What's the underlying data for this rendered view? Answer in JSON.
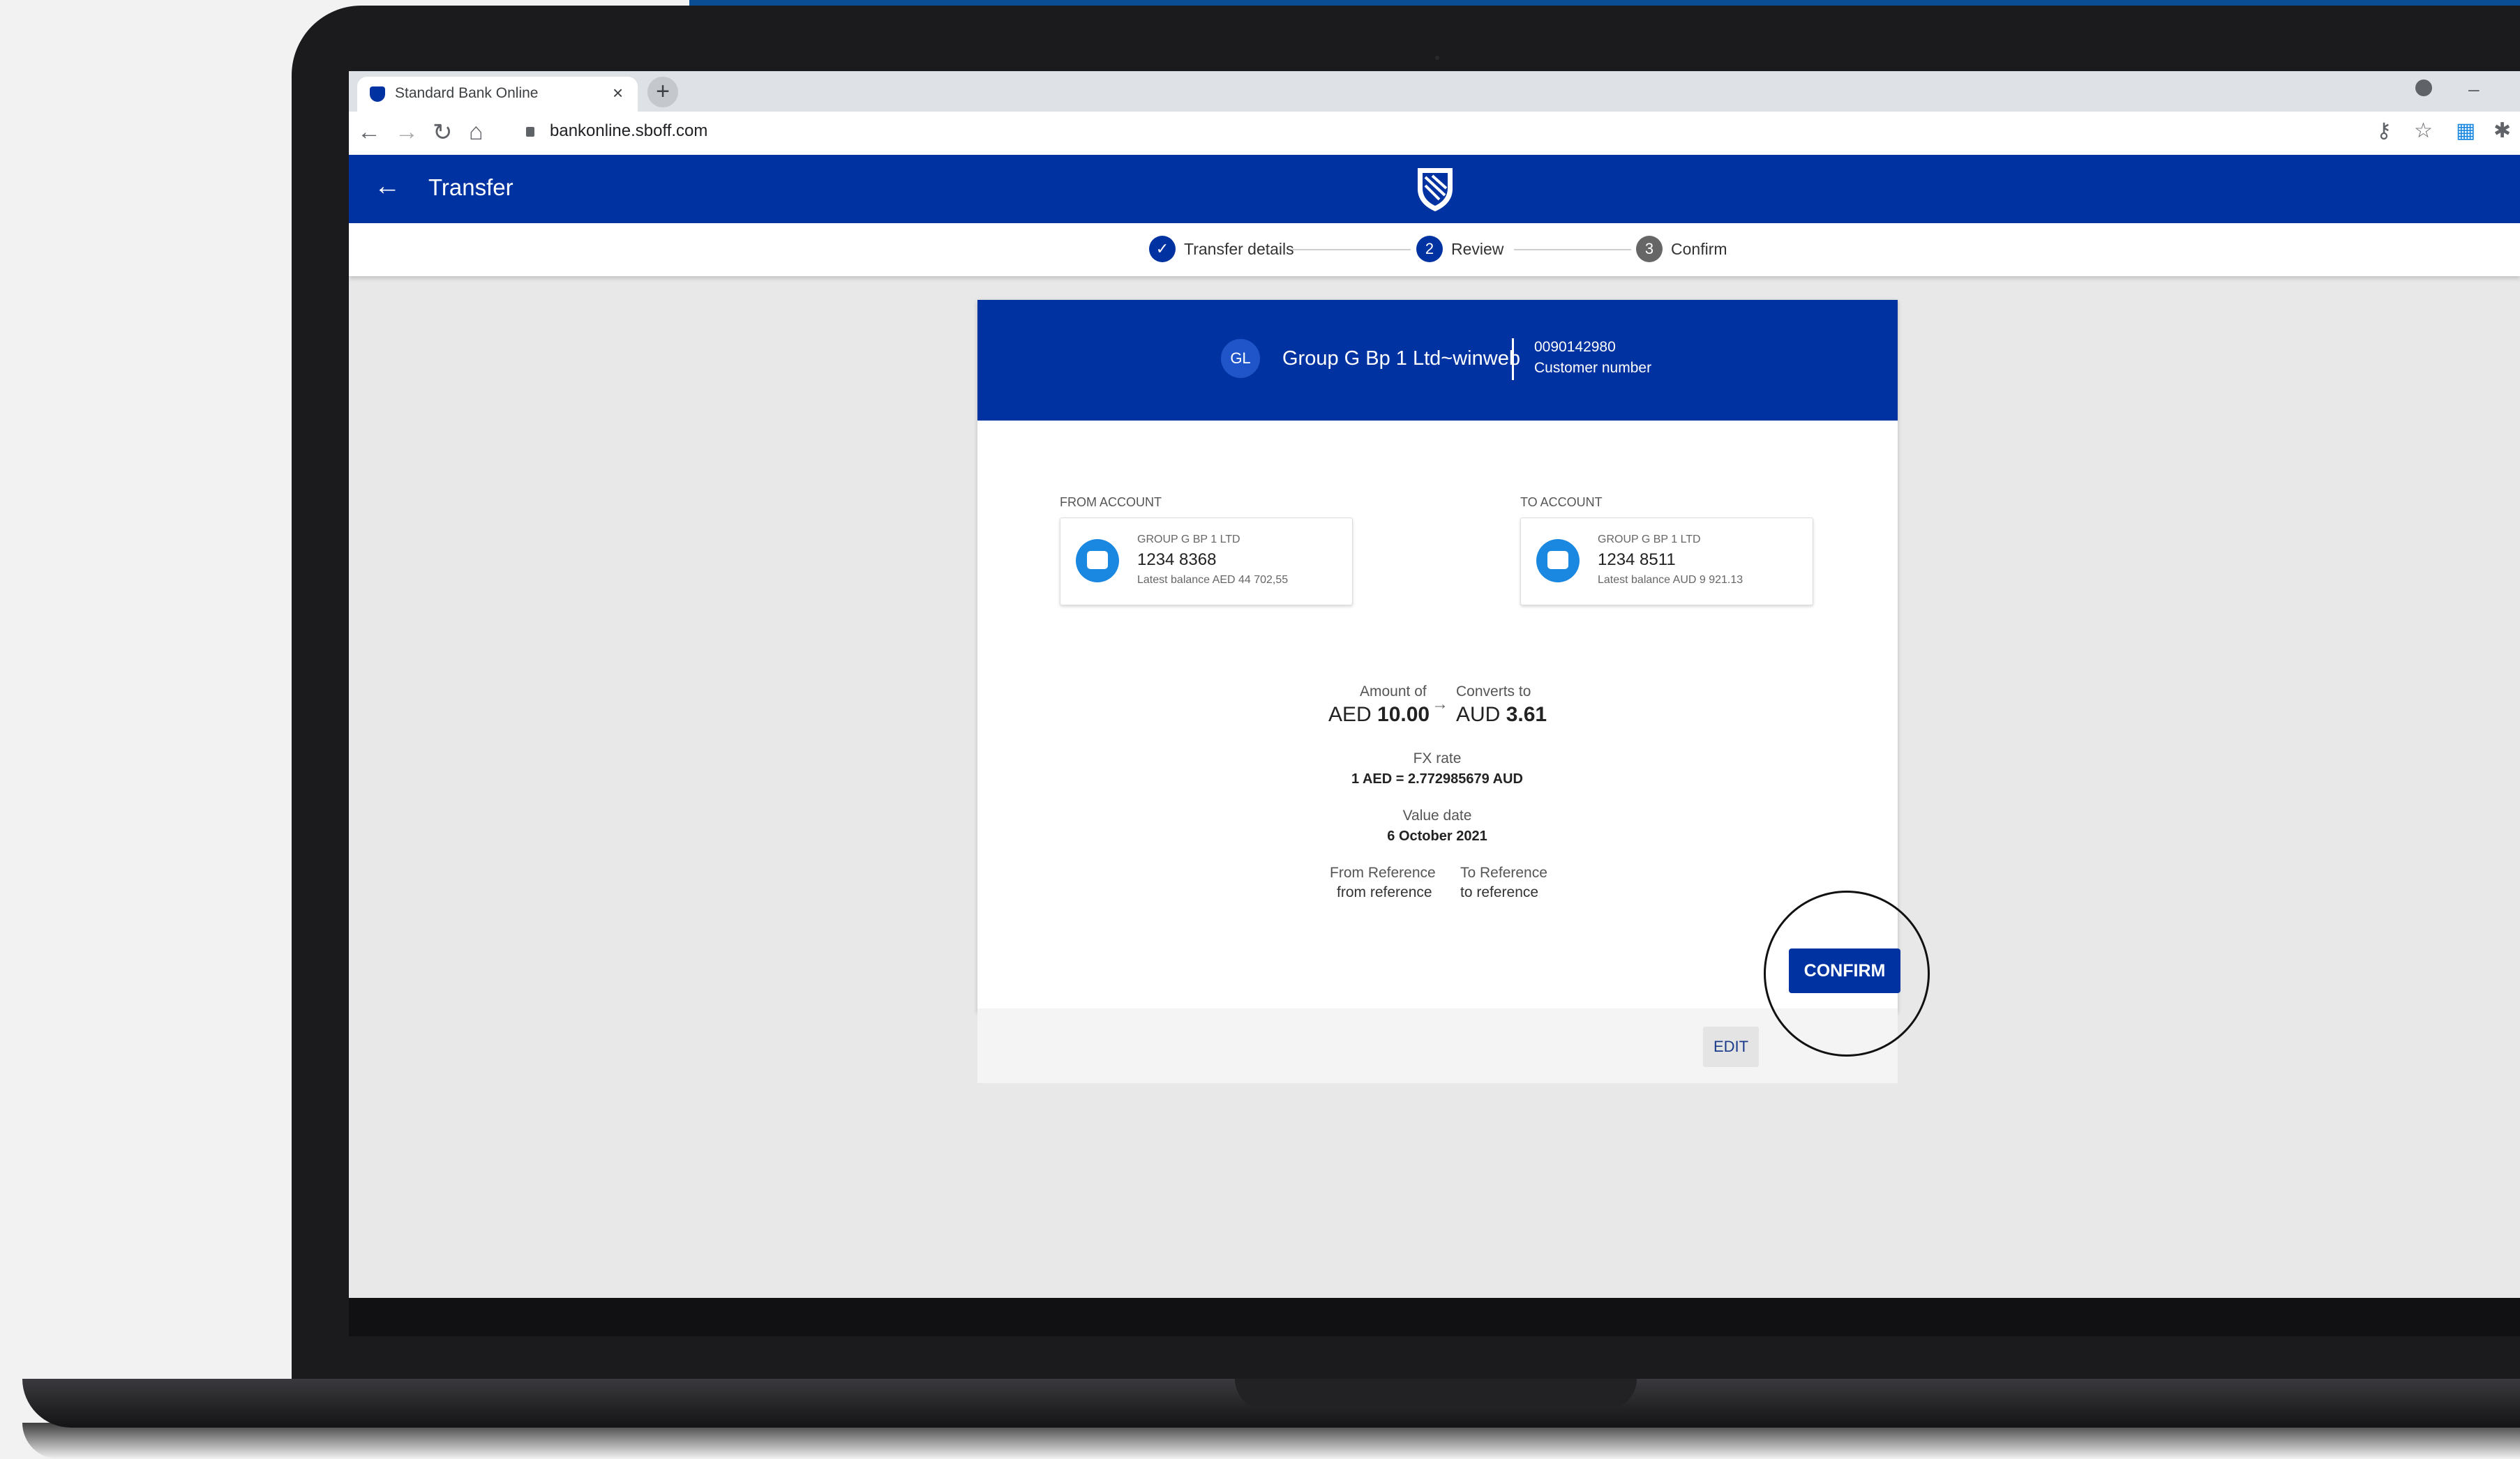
{
  "browser": {
    "tab_title": "Standard Bank Online",
    "tab_close": "×",
    "new_tab": "+",
    "url": "bankonline.sboff.com"
  },
  "app": {
    "back": "←",
    "title": "Transfer"
  },
  "stepper": {
    "steps": [
      {
        "number": "✓",
        "label": "Transfer details",
        "state": "done"
      },
      {
        "number": "2",
        "label": "Review",
        "state": "active"
      },
      {
        "number": "3",
        "label": "Confirm",
        "state": "pending"
      }
    ]
  },
  "customer": {
    "initials": "GL",
    "name": "Group G Bp 1 Ltd~winweb",
    "number": "0090142980",
    "number_label": "Customer number"
  },
  "from_account": {
    "label": "FROM ACCOUNT",
    "owner": "GROUP G BP 1 LTD",
    "number": "1234 8368",
    "balance": "Latest balance AED 44 702,55"
  },
  "to_account": {
    "label": "TO ACCOUNT",
    "owner": "GROUP G BP 1 LTD",
    "number": "1234 8511",
    "balance": "Latest balance AUD 9 921.13"
  },
  "transfer": {
    "amount_label": "Amount of",
    "amount_currency": "AED",
    "amount_value": "10.00",
    "converts_label": "Converts to",
    "converts_currency": "AUD",
    "converts_value": "3.61",
    "arrow": "→",
    "fx_label": "FX rate",
    "fx_value": "1 AED = 2.772985679 AUD",
    "value_date_label": "Value date",
    "value_date": "6 October 2021",
    "from_ref_label": "From Reference",
    "from_ref": "from reference",
    "to_ref_label": "To Reference",
    "to_ref": "to reference"
  },
  "actions": {
    "edit": "EDIT",
    "confirm": "CONFIRM"
  },
  "colors": {
    "brand_blue": "#0033a1",
    "wallet_blue": "#1a88e0"
  }
}
